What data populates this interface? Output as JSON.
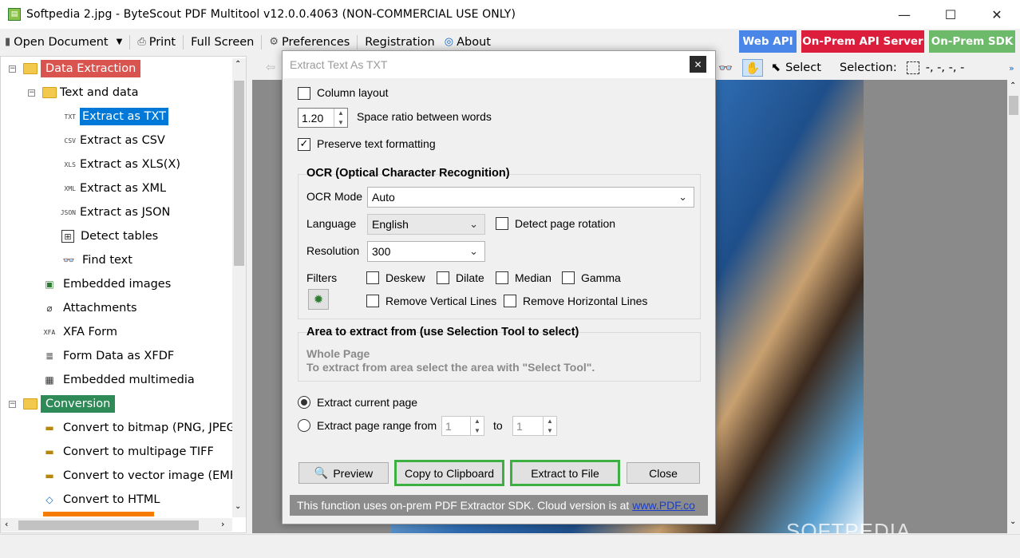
{
  "window": {
    "title": "Softpedia 2.jpg - ByteScout PDF Multitool v12.0.0.4063 (NON-COMMERCIAL USE ONLY)",
    "minimize": "—",
    "maximize": "☐",
    "close": "✕"
  },
  "menu": {
    "open_document": "Open Document",
    "print": "Print",
    "full_screen": "Full Screen",
    "preferences": "Preferences",
    "registration": "Registration",
    "about": "About",
    "web_api": "Web API",
    "on_prem_api_server": "On-Prem API Server",
    "on_prem_sdk": "On-Prem SDK",
    "badge_colors": {
      "web_api": "#4a86e8",
      "on_prem_api_server": "#dc1d3c",
      "on_prem_sdk": "#6dbb6a"
    }
  },
  "tree": {
    "data_extraction": "Data Extraction",
    "text_and_data": "Text and data",
    "extract_txt": "Extract as TXT",
    "extract_csv": "Extract as CSV",
    "extract_xls": "Extract as XLS(X)",
    "extract_xml": "Extract as XML",
    "extract_json": "Extract as JSON",
    "detect_tables": "Detect tables",
    "find_text": "Find text",
    "embedded_images": "Embedded images",
    "attachments": "Attachments",
    "xfa_form": "XFA Form",
    "form_data_xfdf": "Form Data as XFDF",
    "embedded_multimedia": "Embedded multimedia",
    "conversion": "Conversion",
    "convert_bitmap": "Convert to bitmap (PNG, JPEG, .",
    "convert_tiff": "Convert to multipage TIFF",
    "convert_emf": "Convert to vector image (EMF)",
    "convert_html": "Convert to HTML",
    "icons": {
      "txt": "TXT",
      "csv": "CSV",
      "xls": "XLS",
      "xml": "XML",
      "json": "JSON",
      "xfa": "XFA"
    }
  },
  "view_toolbar": {
    "select": "Select",
    "selection_label": "Selection:",
    "selection_value": "-, -, -, -"
  },
  "watermark": "SOFTPEDIA",
  "dialog": {
    "title": "Extract Text As TXT",
    "column_layout": "Column layout",
    "space_ratio_value": "1.20",
    "space_ratio_label": "Space ratio between words",
    "preserve_formatting": "Preserve text formatting",
    "ocr_group_title": "OCR (Optical Character Recognition)",
    "ocr_mode_label": "OCR Mode",
    "ocr_mode_value": "Auto",
    "language_label": "Language",
    "language_value": "English",
    "detect_rotation": "Detect page rotation",
    "resolution_label": "Resolution",
    "resolution_value": "300",
    "filters_label": "Filters",
    "filter_deskew": "Deskew",
    "filter_dilate": "Dilate",
    "filter_median": "Median",
    "filter_gamma": "Gamma",
    "filter_remove_vertical": "Remove Vertical Lines",
    "filter_remove_horizontal": "Remove Horizontal Lines",
    "area_group_title": "Area to extract from (use Selection Tool to select)",
    "area_whole_page": "Whole Page",
    "area_hint": "To extract from area select the area with \"Select Tool\".",
    "extract_current_page": "Extract current page",
    "extract_page_range": "Extract page range from",
    "range_from": "1",
    "range_to_label": "to",
    "range_to": "1",
    "preview_button": "Preview",
    "copy_button": "Copy to Clipboard",
    "extract_file_button": "Extract to File",
    "close_button": "Close",
    "footer_text": "This function uses on-prem PDF Extractor SDK. Cloud version is at",
    "footer_link": "www.PDF.co",
    "checked_mark": "✓"
  }
}
